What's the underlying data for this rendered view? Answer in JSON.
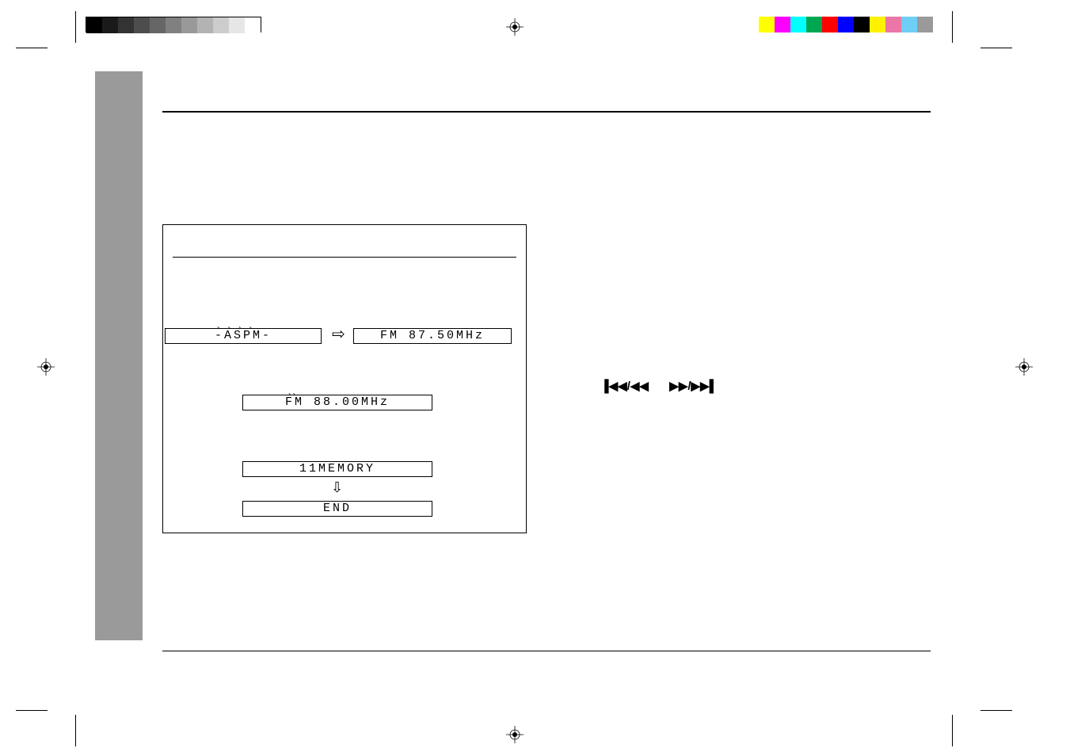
{
  "diagram": {
    "aspm_label": "-ASPM-",
    "fm_start": "FM 87.50MHz",
    "fm_found": "FM 88.00MHz",
    "memory_count": "11MEMORY",
    "end_label": "END",
    "arrow_right": "⇨",
    "arrow_down": "⇩"
  },
  "transport": {
    "prev": "▐◀◀/◀◀",
    "next": "▶▶/▶▶▌"
  },
  "colorbars": {
    "greyscale": [
      "#000000",
      "#1a1a1a",
      "#333333",
      "#4d4d4d",
      "#666666",
      "#808080",
      "#999999",
      "#b3b3b3",
      "#cccccc",
      "#e6e6e6",
      "#ffffff"
    ],
    "process": [
      "#ffff00",
      "#ff00ff",
      "#00ffff",
      "#00a651",
      "#ff0000",
      "#0000ff",
      "#000000",
      "#fff200",
      "#ec77a7",
      "#6dcff6",
      "#9a9a9a"
    ]
  }
}
